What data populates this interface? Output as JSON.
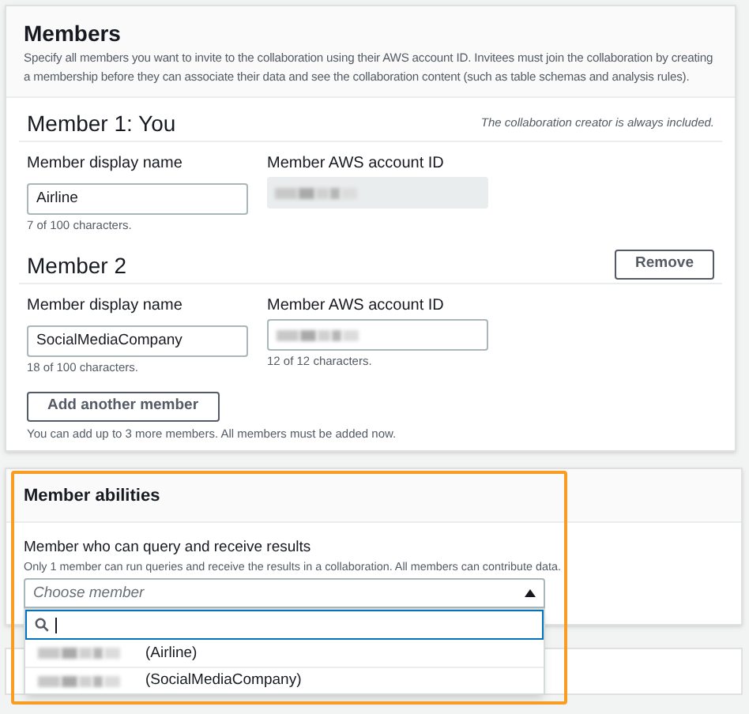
{
  "members_panel": {
    "title": "Members",
    "description": "Specify all members you want to invite to the collaboration using their AWS account ID. Invitees must join the collaboration by creating a membership before they can associate their data and see the collaboration content (such as table schemas and analysis rules).",
    "members": [
      {
        "title": "Member 1: You",
        "note": "The collaboration creator is always included.",
        "name_label": "Member display name",
        "name_value": "Airline",
        "name_count": "7 of 100 characters.",
        "id_label": "Member AWS account ID",
        "id_editable": false
      },
      {
        "title": "Member 2",
        "remove_button": "Remove",
        "name_label": "Member display name",
        "name_value": "SocialMediaCompany",
        "name_count": "18 of 100 characters.",
        "id_label": "Member AWS account ID",
        "id_editable": true,
        "id_count": "12 of 12 characters."
      }
    ],
    "add_button": "Add another member",
    "add_hint": "You can add up to 3 more members. All members must be added now."
  },
  "abilities_panel": {
    "title": "Member abilities",
    "field_label": "Member who can query and receive results",
    "field_hint": "Only 1 member can run queries and receive the results in a collaboration. All members can contribute data.",
    "select_placeholder": "Choose member",
    "expanded": true,
    "options": [
      {
        "label": "(Airline)"
      },
      {
        "label": "(SocialMediaCompany)"
      }
    ]
  }
}
